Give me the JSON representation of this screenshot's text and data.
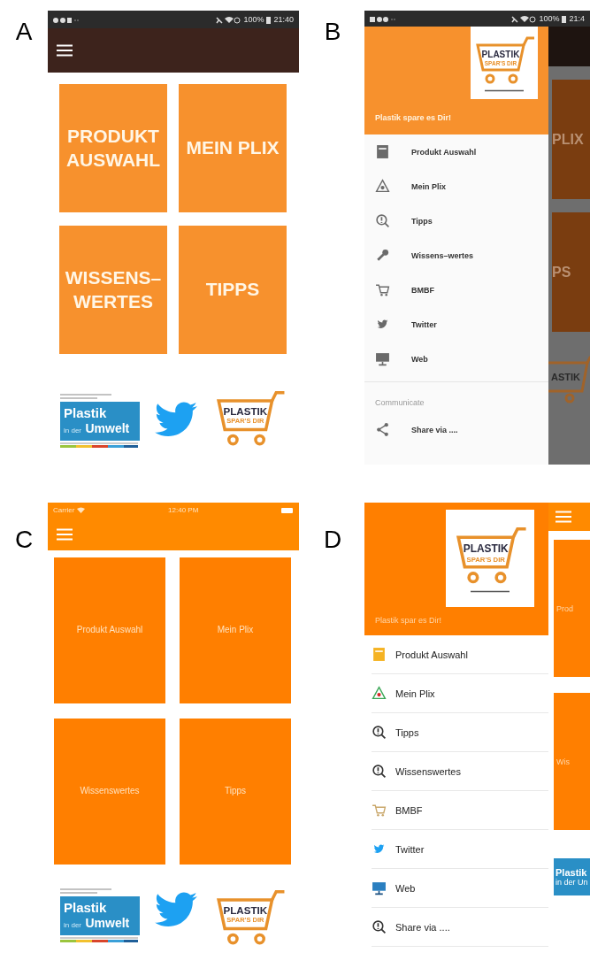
{
  "panels": [
    {
      "label": "A",
      "kind": "home",
      "status_bar": {
        "battery": "100%",
        "time": "21:40"
      },
      "tiles": [
        "PRODUKT\nAUSWAHL",
        "MEIN PLIX",
        "WISSENS–\nWERTES",
        "TIPPS"
      ],
      "footer": {
        "umwelt_logo": [
          "Plastik",
          "in der",
          "Umwelt"
        ],
        "cart_logo": [
          "PLASTIK",
          "SPAR'S DIR"
        ]
      }
    },
    {
      "label": "B",
      "kind": "drawer",
      "status_bar": {
        "battery": "100%",
        "time": "21:4"
      },
      "header_title": "Plastik spare es Dir!",
      "header_logo": [
        "PLASTIK",
        "SPAR'S DIR"
      ],
      "items": [
        {
          "label": "Produkt Auswahl",
          "kind": "box"
        },
        {
          "label": "Mein Plix",
          "kind": "recycle"
        },
        {
          "label": "Tipps",
          "kind": "tips"
        },
        {
          "label": "Wissens–wertes",
          "kind": "wrench"
        },
        {
          "label": "BMBF",
          "kind": "cart"
        },
        {
          "label": "Twitter",
          "kind": "twitter"
        },
        {
          "label": "Web",
          "kind": "monitor"
        }
      ],
      "section": {
        "title": "Communicate",
        "items": [
          {
            "label": "Share via ....",
            "kind": "share"
          }
        ]
      },
      "behind": {
        "tiles": [
          "PLIX",
          "PS"
        ],
        "logo": {
          "kind": "cart",
          "text": [
            "ASTIK"
          ]
        }
      }
    },
    {
      "label": "C",
      "kind": "home",
      "status_bar": {
        "carrier": "Carrier",
        "time": "12:40 PM"
      },
      "tiles": [
        "Produkt Auswahl",
        "Mein Plix",
        "Wissenswertes",
        "Tipps"
      ],
      "footer": {
        "umwelt_logo": [
          "Plastik",
          "in der",
          "Umwelt"
        ],
        "cart_logo": [
          "PLASTIK",
          "SPAR'S DIR"
        ]
      }
    },
    {
      "label": "D",
      "kind": "drawer",
      "header_title": "Plastik spar es Dir!",
      "header_logo": [
        "PLASTIK",
        "SPAR'S DIR"
      ],
      "items": [
        {
          "label": "Produkt Auswahl",
          "kind": "box"
        },
        {
          "label": "Mein Plix",
          "kind": "recycle"
        },
        {
          "label": "Tipps",
          "kind": "tips"
        },
        {
          "label": "Wissenswertes",
          "kind": "tips"
        },
        {
          "label": "BMBF",
          "kind": "cart"
        },
        {
          "label": "Twitter",
          "kind": "twitter"
        },
        {
          "label": "Web",
          "kind": "monitor"
        },
        {
          "label": "Share via ....",
          "kind": "tips"
        }
      ],
      "behind": {
        "tiles": [
          "Prod",
          "Wis"
        ],
        "logo": {
          "kind": "umwelt",
          "text": [
            "Plastik",
            "in der Un"
          ]
        }
      }
    }
  ]
}
